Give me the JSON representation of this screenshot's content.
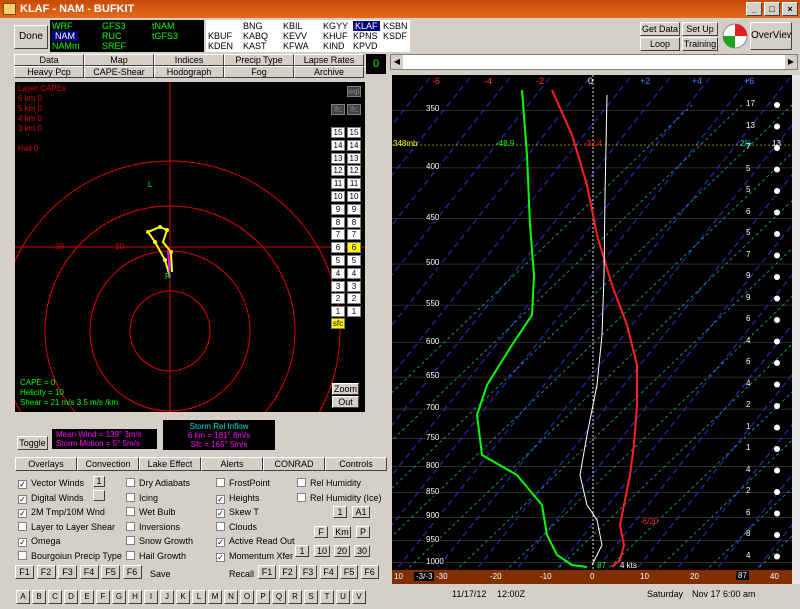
{
  "window": {
    "title": "KLAF - NAM - BUFKIT"
  },
  "toolbar": {
    "done": "Done",
    "get_data": "Get Data",
    "set_up": "Set Up",
    "loop": "Loop",
    "training": "Training",
    "overview": "OverView"
  },
  "models": [
    {
      "label": "WRF",
      "color": "#00ff00"
    },
    {
      "label": "GFS3",
      "color": "#00ff00"
    },
    {
      "label": "tNAM",
      "color": "#00ff00"
    },
    {
      "label": "NAM",
      "color": "#ffffff",
      "selected": true
    },
    {
      "label": "RUC",
      "color": "#00ff00"
    },
    {
      "label": "tGFS3",
      "color": "#00ff00"
    },
    {
      "label": "NAMm",
      "color": "#00ff00"
    },
    {
      "label": "SREF",
      "color": "#00ff00"
    }
  ],
  "stations": [
    "BNG",
    "KBIL",
    "KGYY",
    "KLAF",
    "KSBN",
    "KBUF",
    "KABQ",
    "KEVV",
    "KHUF",
    "KPNS",
    "KSDF",
    "KDEN",
    "KAST",
    "KFWA",
    "KIND",
    "KPVD"
  ],
  "tabs_row1": [
    "Data",
    "Map",
    "Indices",
    "Precip Type",
    "Lapse Rates"
  ],
  "tabs_row2": [
    "Heavy Pcp",
    "CAPE-Shear",
    "Hodograph",
    "Fog",
    "Archive"
  ],
  "frame_counter": "0",
  "hodo": {
    "layer_capes_title": "Layer CAPEs",
    "layer_capes": [
      "6 km  0",
      "5 km  0",
      "4 km  0",
      "3 km  0"
    ],
    "hail": "Hail  0",
    "ring_label": "20",
    "ring_label2": "10",
    "left_label": "L",
    "right_label": "R",
    "cape": "CAPE = 0",
    "helicity": "Helicity = 10",
    "shear": "Shear = 21 m/s    3.5 m/s /km",
    "lfc1": "lfc",
    "lfc2": "lfc",
    "eql": "eql",
    "layers": [
      "15",
      "14",
      "13",
      "12",
      "11",
      "10",
      "9",
      "8",
      "7",
      "6",
      "5",
      "4",
      "3",
      "2",
      "1"
    ],
    "sfc": "sfc",
    "zoom": "Zoom",
    "out": "Out"
  },
  "wind": {
    "toggle": "Toggle",
    "mean_wind": "Mean Wind = 139°  3m/s",
    "storm_motion": "Storm Motion = 5°  5m/s",
    "inflow_title": "Storm Rel Inflow",
    "inflow_6km": "6 km = 181°  8m/s",
    "inflow_sfc": "Sfc = 165°  5m/s"
  },
  "panel_tabs": [
    "Overlays",
    "Convection",
    "Lake Effect",
    "Alerts",
    "CONRAD",
    "Controls"
  ],
  "checkboxes": {
    "col1": [
      {
        "l": "Vector Winds",
        "c": true
      },
      {
        "l": "Digital Winds",
        "c": true
      },
      {
        "l": "2M Tmp/10M Wnd",
        "c": true
      },
      {
        "l": "Layer to Layer Shear",
        "c": false
      },
      {
        "l": "Omega",
        "c": true
      },
      {
        "l": "Bourgoiun Precip Type",
        "c": false
      }
    ],
    "col2": [
      {
        "l": "Dry Adiabats",
        "c": false
      },
      {
        "l": "Icing",
        "c": false
      },
      {
        "l": "Wet Bulb",
        "c": false
      },
      {
        "l": "Inversions",
        "c": false
      },
      {
        "l": "Snow Growth",
        "c": false
      },
      {
        "l": "Hail Growth",
        "c": false
      }
    ],
    "col3": [
      {
        "l": "FrostPoint",
        "c": false
      },
      {
        "l": "Heights",
        "c": true
      },
      {
        "l": "Skew T",
        "c": true
      },
      {
        "l": "Clouds",
        "c": false
      },
      {
        "l": "Active Read Out",
        "c": true
      },
      {
        "l": "Momentum Xfer",
        "c": true
      }
    ],
    "col4": [
      {
        "l": "Rel Humidity",
        "c": false
      },
      {
        "l": "Rel Humidity (Ice)",
        "c": false
      }
    ]
  },
  "small_btns": {
    "one": "1",
    "a1": "A1",
    "f": "F",
    "km": "Km",
    "p": "P",
    "b1": "1",
    "b10": "10",
    "b20": "20",
    "b30": "30"
  },
  "fkeys_left": [
    "F1",
    "F2",
    "F3",
    "F4",
    "F5",
    "F6"
  ],
  "save": "Save",
  "recall": "Recall",
  "fkeys_right": [
    "F1",
    "F2",
    "F3",
    "F4",
    "F5",
    "F6"
  ],
  "letters": [
    "A",
    "B",
    "C",
    "D",
    "E",
    "F",
    "G",
    "H",
    "I",
    "J",
    "K",
    "L",
    "M",
    "N",
    "O",
    "P",
    "Q",
    "R",
    "S",
    "T",
    "U",
    "V"
  ],
  "skewt": {
    "top_axis": [
      "-6",
      "-4",
      "-2",
      "0",
      "+2",
      "+4",
      "+6"
    ],
    "pressures": [
      "350",
      "400",
      "450",
      "500",
      "550",
      "600",
      "650",
      "700",
      "750",
      "800",
      "850",
      "900",
      "950",
      "1000"
    ],
    "readout_p": "348mb",
    "readout_td": "-48.9",
    "readout_t": "-32.4",
    "readout_rh": "2%",
    "readout_h": "13",
    "wind_speeds": [
      "17",
      "13",
      "7",
      "5",
      "5",
      "6",
      "5",
      "7",
      "9",
      "9",
      "6",
      "4",
      "6",
      "4",
      "2",
      "1",
      "1",
      "4",
      "2",
      "6",
      "8",
      "4"
    ],
    "label_900": "-6/20",
    "sfc_label": "87",
    "sfc_wind": "4 kts"
  },
  "bottom_axis": [
    "10",
    "-3/-3",
    "-30",
    "-20",
    "-10",
    "0",
    "10",
    "20",
    "30",
    "40"
  ],
  "bottom_value": "87",
  "status": {
    "date": "11/17/12",
    "time": "12:00Z",
    "day": "Saturday",
    "valid": "Nov 17  6:00 am"
  }
}
